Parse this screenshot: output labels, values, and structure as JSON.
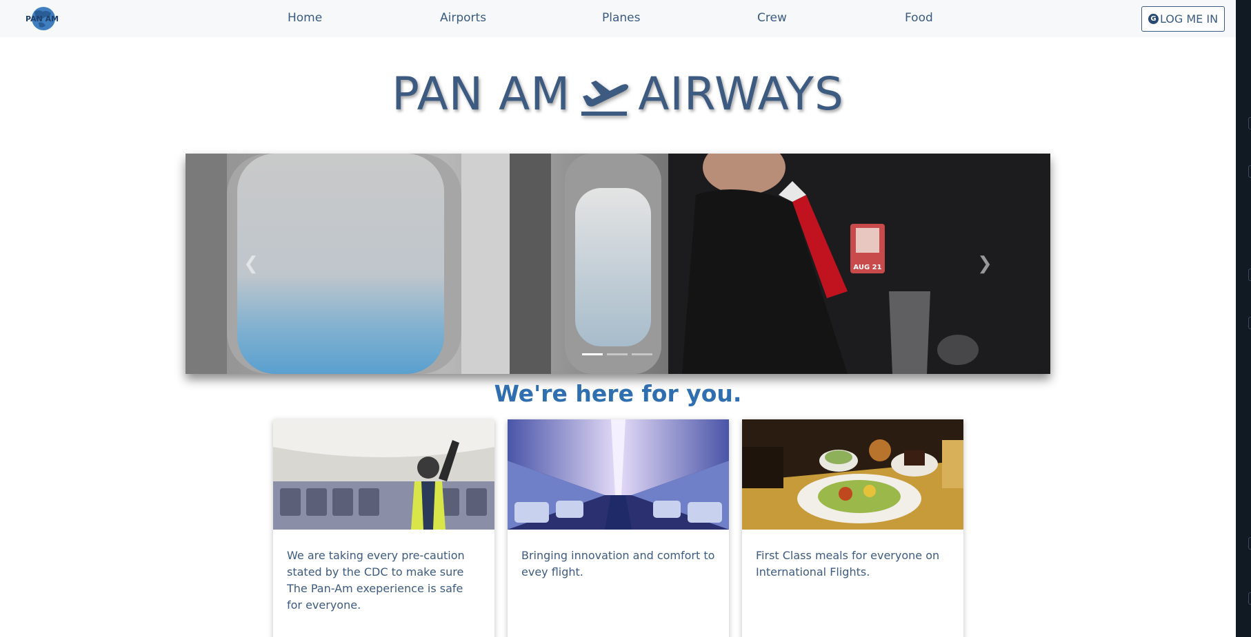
{
  "nav": {
    "logo_text": "PAN AM",
    "links": [
      "Home",
      "Airports",
      "Planes",
      "Crew",
      "Food"
    ],
    "login_label": "LOG ME IN",
    "login_icon": "google-icon"
  },
  "hero": {
    "title_left": "PAN AM",
    "title_right": "AIRWAYS",
    "icon": "plane-takeoff-icon"
  },
  "carousel": {
    "prev_icon": "chevron-left-icon",
    "next_icon": "chevron-right-icon",
    "slide_count": 3,
    "active_slide": 1,
    "badge_text": "AUG 21"
  },
  "section": {
    "title": "We're here for you."
  },
  "cards": [
    {
      "text": "We are taking every pre-caution stated by the CDC to make sure The Pan-Am exeperience is safe for everyone."
    },
    {
      "text": "Bringing innovation and comfort to evey flight."
    },
    {
      "text": "First Class meals for everyone on International Flights."
    }
  ],
  "colors": {
    "brand": "#3d5a80",
    "accent": "#2f6fb0",
    "navbar_bg": "#f7f8fa"
  }
}
